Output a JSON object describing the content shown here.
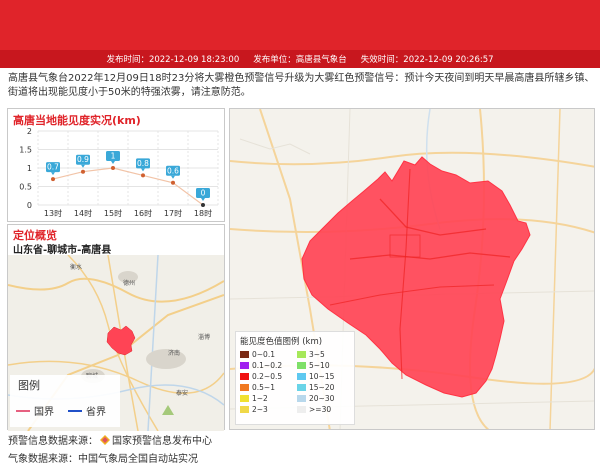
{
  "header": {
    "publish_label": "发布时间：",
    "publish_time": "2022-12-09 18:23:00",
    "unit_label": "发布单位：",
    "unit": "高唐县气象台",
    "expire_label": "失效时间：",
    "expire_time": "2022-12-09 20:26:57"
  },
  "message": "高唐县气象台2022年12月09日18时23分将大雾橙色预警信号升级为大雾红色预警信号：预计今天夜间到明天早晨高唐县所辖乡镇、街道将出现能见度小于50米的特强浓雾，请注意防范。",
  "visibility": {
    "title": "高唐当地能见度实况(km)",
    "chart_data": {
      "type": "line",
      "categories": [
        "13时",
        "14时",
        "15时",
        "16时",
        "17时",
        "18时"
      ],
      "values": [
        0.7,
        0.9,
        1,
        0.8,
        0.6,
        0
      ],
      "labels": [
        "0.7",
        "0.9",
        "1",
        "0.8",
        "0.6",
        "0"
      ],
      "ylim": [
        0,
        2
      ],
      "yticks": [
        "0",
        "0.5",
        "1",
        "1.5",
        "2"
      ],
      "grid": true
    }
  },
  "location": {
    "title": "定位概览",
    "path": "山东省-聊城市-高唐县",
    "place_labels": {
      "liaocheng": "聊城",
      "jinan": "济南",
      "hengshui": "衡水",
      "dezhou": "德州",
      "zibo": "淄博",
      "taian": "泰安"
    },
    "legend": {
      "title": "图例",
      "national": "国界",
      "provincial": "省界",
      "national_color": "#e66080",
      "provincial_color": "#2050c8"
    }
  },
  "map": {
    "legend_title": "能见度色值图例 (km)",
    "legend_items": [
      {
        "label": "0~0.1",
        "color": "#7a2a14"
      },
      {
        "label": "3~5",
        "color": "#a6e85a"
      },
      {
        "label": "0.1~0.2",
        "color": "#a020f0"
      },
      {
        "label": "5~10",
        "color": "#7ee068"
      },
      {
        "label": "0.2~0.5",
        "color": "#f01010"
      },
      {
        "label": "10~15",
        "color": "#5ec8f0"
      },
      {
        "label": "0.5~1",
        "color": "#f07820"
      },
      {
        "label": "15~20",
        "color": "#6ad4e8"
      },
      {
        "label": "1~2",
        "color": "#f0e030"
      },
      {
        "label": "20~30",
        "color": "#b8d8ec"
      },
      {
        "label": "2~3",
        "color": "#f0d848"
      },
      {
        "label": ">=30",
        "color": "#eeeeee"
      }
    ],
    "county_fill": "#ff4455"
  },
  "sources": {
    "warning_label": "预警信息数据来源：",
    "warning_source": "国家预警信息发布中心",
    "weather_label": "气象数据来源：",
    "weather_source": "中国气象局全国自动站实况"
  }
}
